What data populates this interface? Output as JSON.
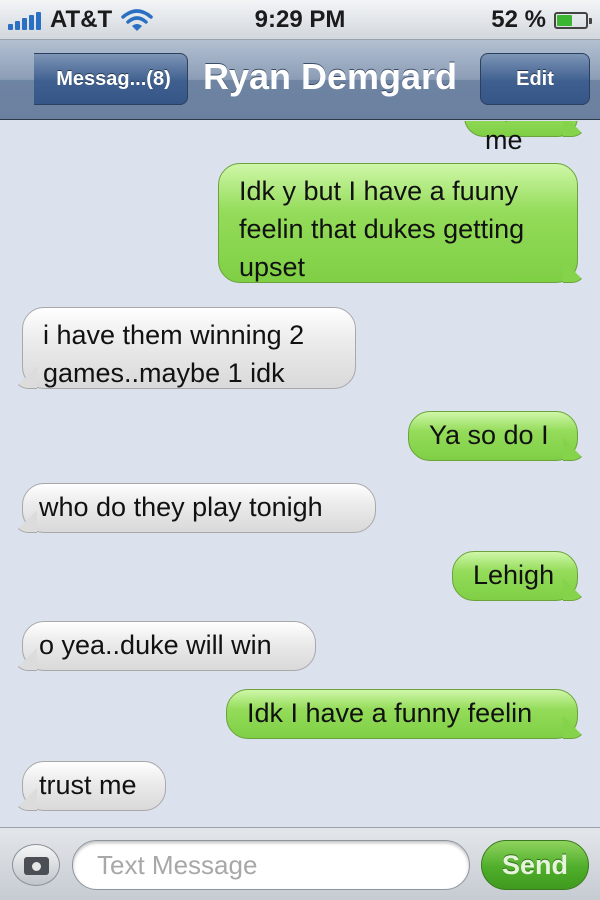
{
  "status_bar": {
    "carrier": "AT&T",
    "time": "9:29 PM",
    "battery_percent": "52 %",
    "battery_level": 0.52,
    "signal_icon": "signal-bars-icon",
    "wifi_icon": "wifi-icon",
    "battery_icon": "battery-icon"
  },
  "nav_bar": {
    "back_label": "Messag...(8)",
    "title": "Ryan Demgard",
    "edit_label": "Edit"
  },
  "messages": [
    {
      "direction": "sent",
      "text": "Ya me"
    },
    {
      "direction": "sent",
      "text": "Idk y but I have a fuuny feelin that dukes getting upset"
    },
    {
      "direction": "received",
      "text": "i have them winning 2 games..maybe 1 idk"
    },
    {
      "direction": "sent",
      "text": "Ya so do I"
    },
    {
      "direction": "received",
      "text": "who do they play tonigh"
    },
    {
      "direction": "sent",
      "text": "Lehigh"
    },
    {
      "direction": "received",
      "text": "o yea..duke will win"
    },
    {
      "direction": "sent",
      "text": "Idk I have a funny feelin"
    },
    {
      "direction": "received",
      "text": "trust me"
    }
  ],
  "input_bar": {
    "camera_icon": "camera-icon",
    "placeholder": "Text Message",
    "send_label": "Send"
  },
  "colors": {
    "sent_bubble": "#8fd95a",
    "received_bubble": "#e6e6e6",
    "background": "#dbe2ed",
    "nav_blue": "#6d83a2"
  }
}
